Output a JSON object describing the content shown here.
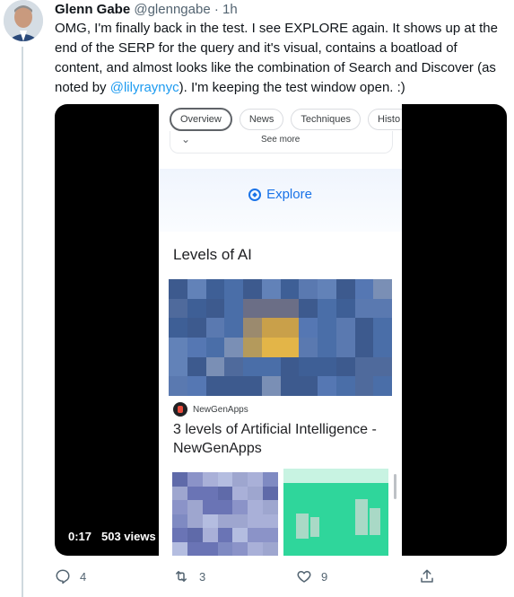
{
  "tweet": {
    "author_name": "Glenn Gabe",
    "handle": "@glenngabe",
    "separator": "·",
    "time_ago": "1h",
    "text_before_mention": "OMG, I'm finally back in the test. I see EXPLORE again. It shows up at the end of the SERP for the query and it's visual, contains a boatload of content, and almost looks like the combination of Search and Discover (as noted by ",
    "mention": "@lilyraynyc",
    "text_after_mention": "). I'm keeping the test window open. :)"
  },
  "video": {
    "timestamp": "0:17",
    "views": "503 views",
    "screen": {
      "tabs": [
        "Overview",
        "News",
        "Techniques",
        "Histo"
      ],
      "active_tab_index": 0,
      "see_more_label": "See more",
      "explore_label": "Explore",
      "section_title": "Levels of AI",
      "source_name": "NewGenApps",
      "article_title": "3 levels of Artificial Intelligence - NewGenApps"
    }
  },
  "actions": {
    "replies": "4",
    "retweets": "3",
    "likes": "9"
  },
  "colors": {
    "accent": "#1d9bf0",
    "google_blue": "#1a73e8",
    "muted": "#536471"
  },
  "icons": [
    "reply-icon",
    "retweet-icon",
    "like-icon",
    "share-icon",
    "explore-compass-icon",
    "chevron-down-icon"
  ]
}
